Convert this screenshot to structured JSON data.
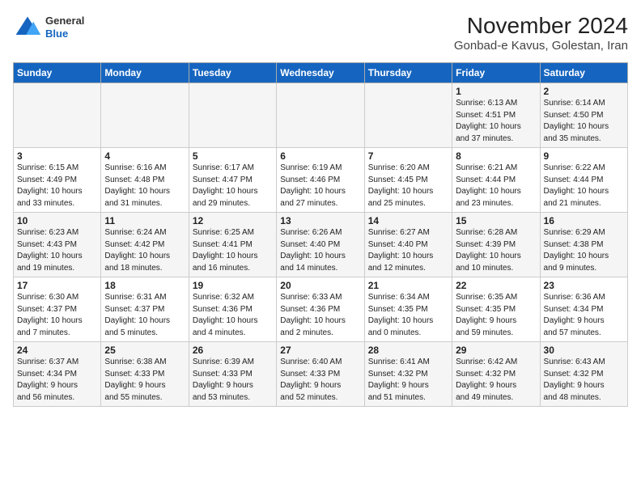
{
  "logo": {
    "general": "General",
    "blue": "Blue"
  },
  "title": "November 2024",
  "subtitle": "Gonbad-e Kavus, Golestan, Iran",
  "weekdays": [
    "Sunday",
    "Monday",
    "Tuesday",
    "Wednesday",
    "Thursday",
    "Friday",
    "Saturday"
  ],
  "weeks": [
    [
      {
        "day": "",
        "info": ""
      },
      {
        "day": "",
        "info": ""
      },
      {
        "day": "",
        "info": ""
      },
      {
        "day": "",
        "info": ""
      },
      {
        "day": "",
        "info": ""
      },
      {
        "day": "1",
        "info": "Sunrise: 6:13 AM\nSunset: 4:51 PM\nDaylight: 10 hours\nand 37 minutes."
      },
      {
        "day": "2",
        "info": "Sunrise: 6:14 AM\nSunset: 4:50 PM\nDaylight: 10 hours\nand 35 minutes."
      }
    ],
    [
      {
        "day": "3",
        "info": "Sunrise: 6:15 AM\nSunset: 4:49 PM\nDaylight: 10 hours\nand 33 minutes."
      },
      {
        "day": "4",
        "info": "Sunrise: 6:16 AM\nSunset: 4:48 PM\nDaylight: 10 hours\nand 31 minutes."
      },
      {
        "day": "5",
        "info": "Sunrise: 6:17 AM\nSunset: 4:47 PM\nDaylight: 10 hours\nand 29 minutes."
      },
      {
        "day": "6",
        "info": "Sunrise: 6:19 AM\nSunset: 4:46 PM\nDaylight: 10 hours\nand 27 minutes."
      },
      {
        "day": "7",
        "info": "Sunrise: 6:20 AM\nSunset: 4:45 PM\nDaylight: 10 hours\nand 25 minutes."
      },
      {
        "day": "8",
        "info": "Sunrise: 6:21 AM\nSunset: 4:44 PM\nDaylight: 10 hours\nand 23 minutes."
      },
      {
        "day": "9",
        "info": "Sunrise: 6:22 AM\nSunset: 4:44 PM\nDaylight: 10 hours\nand 21 minutes."
      }
    ],
    [
      {
        "day": "10",
        "info": "Sunrise: 6:23 AM\nSunset: 4:43 PM\nDaylight: 10 hours\nand 19 minutes."
      },
      {
        "day": "11",
        "info": "Sunrise: 6:24 AM\nSunset: 4:42 PM\nDaylight: 10 hours\nand 18 minutes."
      },
      {
        "day": "12",
        "info": "Sunrise: 6:25 AM\nSunset: 4:41 PM\nDaylight: 10 hours\nand 16 minutes."
      },
      {
        "day": "13",
        "info": "Sunrise: 6:26 AM\nSunset: 4:40 PM\nDaylight: 10 hours\nand 14 minutes."
      },
      {
        "day": "14",
        "info": "Sunrise: 6:27 AM\nSunset: 4:40 PM\nDaylight: 10 hours\nand 12 minutes."
      },
      {
        "day": "15",
        "info": "Sunrise: 6:28 AM\nSunset: 4:39 PM\nDaylight: 10 hours\nand 10 minutes."
      },
      {
        "day": "16",
        "info": "Sunrise: 6:29 AM\nSunset: 4:38 PM\nDaylight: 10 hours\nand 9 minutes."
      }
    ],
    [
      {
        "day": "17",
        "info": "Sunrise: 6:30 AM\nSunset: 4:37 PM\nDaylight: 10 hours\nand 7 minutes."
      },
      {
        "day": "18",
        "info": "Sunrise: 6:31 AM\nSunset: 4:37 PM\nDaylight: 10 hours\nand 5 minutes."
      },
      {
        "day": "19",
        "info": "Sunrise: 6:32 AM\nSunset: 4:36 PM\nDaylight: 10 hours\nand 4 minutes."
      },
      {
        "day": "20",
        "info": "Sunrise: 6:33 AM\nSunset: 4:36 PM\nDaylight: 10 hours\nand 2 minutes."
      },
      {
        "day": "21",
        "info": "Sunrise: 6:34 AM\nSunset: 4:35 PM\nDaylight: 10 hours\nand 0 minutes."
      },
      {
        "day": "22",
        "info": "Sunrise: 6:35 AM\nSunset: 4:35 PM\nDaylight: 9 hours\nand 59 minutes."
      },
      {
        "day": "23",
        "info": "Sunrise: 6:36 AM\nSunset: 4:34 PM\nDaylight: 9 hours\nand 57 minutes."
      }
    ],
    [
      {
        "day": "24",
        "info": "Sunrise: 6:37 AM\nSunset: 4:34 PM\nDaylight: 9 hours\nand 56 minutes."
      },
      {
        "day": "25",
        "info": "Sunrise: 6:38 AM\nSunset: 4:33 PM\nDaylight: 9 hours\nand 55 minutes."
      },
      {
        "day": "26",
        "info": "Sunrise: 6:39 AM\nSunset: 4:33 PM\nDaylight: 9 hours\nand 53 minutes."
      },
      {
        "day": "27",
        "info": "Sunrise: 6:40 AM\nSunset: 4:33 PM\nDaylight: 9 hours\nand 52 minutes."
      },
      {
        "day": "28",
        "info": "Sunrise: 6:41 AM\nSunset: 4:32 PM\nDaylight: 9 hours\nand 51 minutes."
      },
      {
        "day": "29",
        "info": "Sunrise: 6:42 AM\nSunset: 4:32 PM\nDaylight: 9 hours\nand 49 minutes."
      },
      {
        "day": "30",
        "info": "Sunrise: 6:43 AM\nSunset: 4:32 PM\nDaylight: 9 hours\nand 48 minutes."
      }
    ]
  ]
}
